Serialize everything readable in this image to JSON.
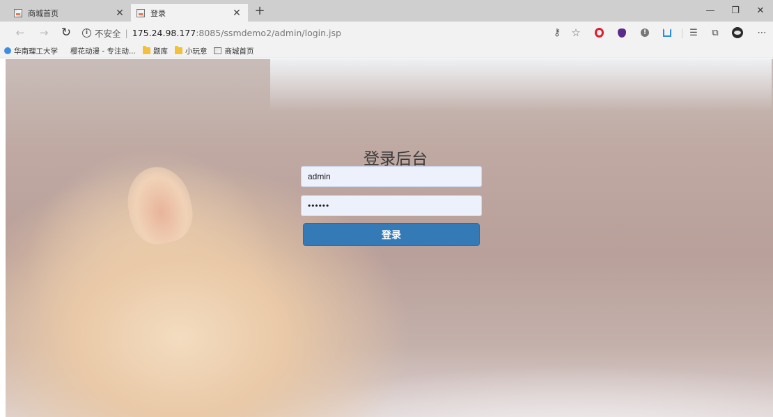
{
  "tabs": [
    {
      "title": "商城首页"
    },
    {
      "title": "登录"
    }
  ],
  "window_controls": {
    "minimize": "—",
    "maximize": "❐",
    "close": "✕"
  },
  "addressbar": {
    "security_label": "不安全",
    "separator": "|",
    "url_host": "175.24.98.177",
    "url_rest": ":8085/ssmdemo2/admin/login.jsp"
  },
  "bookmarks": [
    {
      "label": "华南理工大学",
      "icon": "university-icon"
    },
    {
      "label": "樱花动漫 - 专注动...",
      "icon": "none"
    },
    {
      "label": "题库",
      "icon": "folder-icon"
    },
    {
      "label": "小玩意",
      "icon": "folder-icon"
    },
    {
      "label": "商城首页",
      "icon": "image-icon"
    }
  ],
  "login": {
    "title": "登录后台",
    "username_value": "admin",
    "password_value": "123456",
    "submit_label": "登录"
  }
}
